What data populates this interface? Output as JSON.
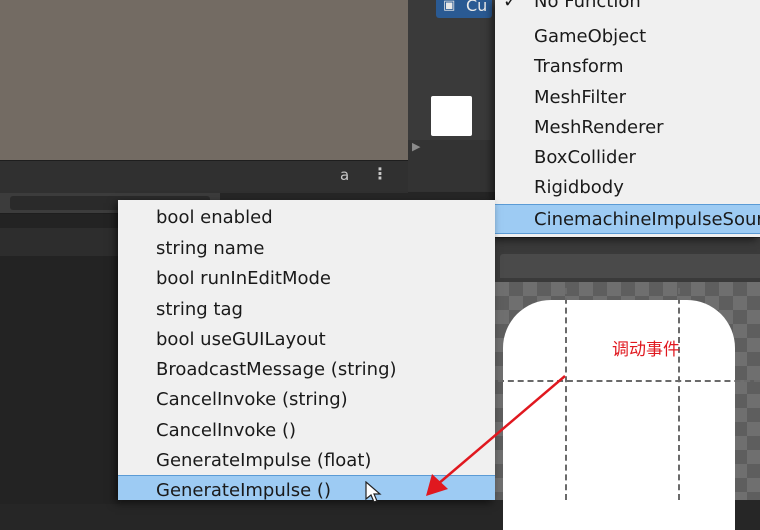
{
  "inspector": {
    "object_tab_label": "Cu"
  },
  "component_menu": {
    "items": [
      {
        "label": "No Function",
        "checked": true
      },
      {
        "label": "GameObject"
      },
      {
        "label": "Transform"
      },
      {
        "label": "MeshFilter"
      },
      {
        "label": "MeshRenderer"
      },
      {
        "label": "BoxCollider"
      },
      {
        "label": "Rigidbody"
      },
      {
        "label": "CinemachineImpulseSour",
        "highlighted": true
      }
    ]
  },
  "function_menu": {
    "items": [
      {
        "label": "bool enabled"
      },
      {
        "label": "string name"
      },
      {
        "label": "bool runInEditMode"
      },
      {
        "label": "string tag"
      },
      {
        "label": "bool useGUILayout"
      },
      {
        "label": "BroadcastMessage (string)"
      },
      {
        "label": "CancelInvoke (string)"
      },
      {
        "label": "CancelInvoke ()"
      },
      {
        "label": "GenerateImpulse (float)"
      },
      {
        "label": "GenerateImpulse ()",
        "selected": true
      }
    ]
  },
  "annotation": {
    "text": "调动事件",
    "color": "#e0181f"
  },
  "colors": {
    "menu_background": "#f0f0f0",
    "highlight": "#9dcbf3",
    "scene_background": "#736b63",
    "tab_accent": "#2a5a93"
  },
  "icons": {
    "lock": "lock-icon",
    "kebab": "kebab-menu-icon",
    "check": "checkmark-icon",
    "cube": "cube-icon",
    "cursor": "mouse-cursor-icon"
  }
}
